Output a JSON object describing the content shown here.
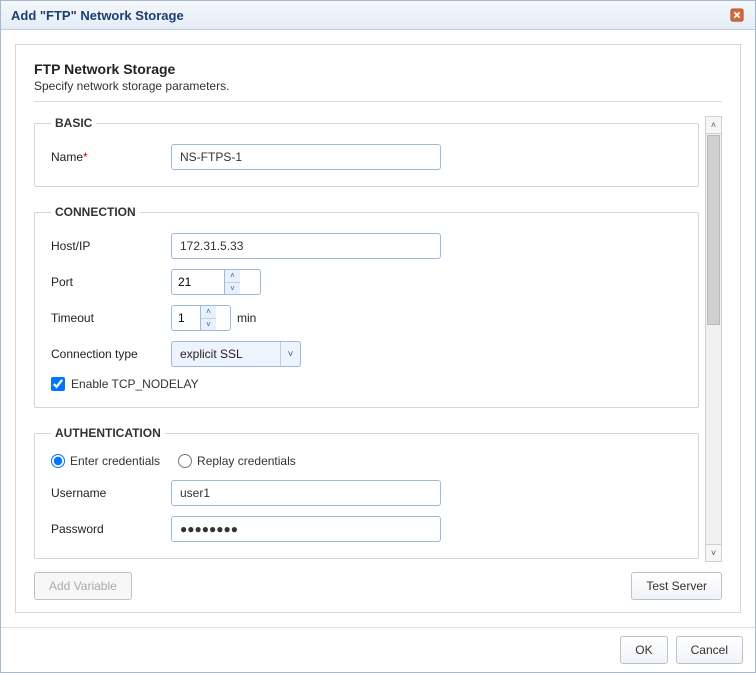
{
  "titlebar": {
    "title": "Add \"FTP\" Network Storage"
  },
  "header": {
    "title": "FTP Network Storage",
    "subtitle": "Specify network storage parameters."
  },
  "groups": {
    "basic": {
      "legend": "BASIC",
      "name_label": "Name",
      "name_value": "NS-FTPS-1"
    },
    "connection": {
      "legend": "CONNECTION",
      "host_label": "Host/IP",
      "host_value": "172.31.5.33",
      "port_label": "Port",
      "port_value": "21",
      "timeout_label": "Timeout",
      "timeout_value": "1",
      "timeout_unit": "min",
      "conntype_label": "Connection type",
      "conntype_value": "explicit SSL",
      "nodelay_label": "Enable TCP_NODELAY",
      "nodelay_checked": true
    },
    "auth": {
      "legend": "AUTHENTICATION",
      "radio_enter": "Enter credentials",
      "radio_replay": "Replay credentials",
      "radio_selected": "enter",
      "username_label": "Username",
      "username_value": "user1",
      "password_label": "Password",
      "password_value": "●●●●●●●●"
    }
  },
  "buttons": {
    "add_variable": "Add Variable",
    "test_server": "Test Server",
    "ok": "OK",
    "cancel": "Cancel"
  }
}
